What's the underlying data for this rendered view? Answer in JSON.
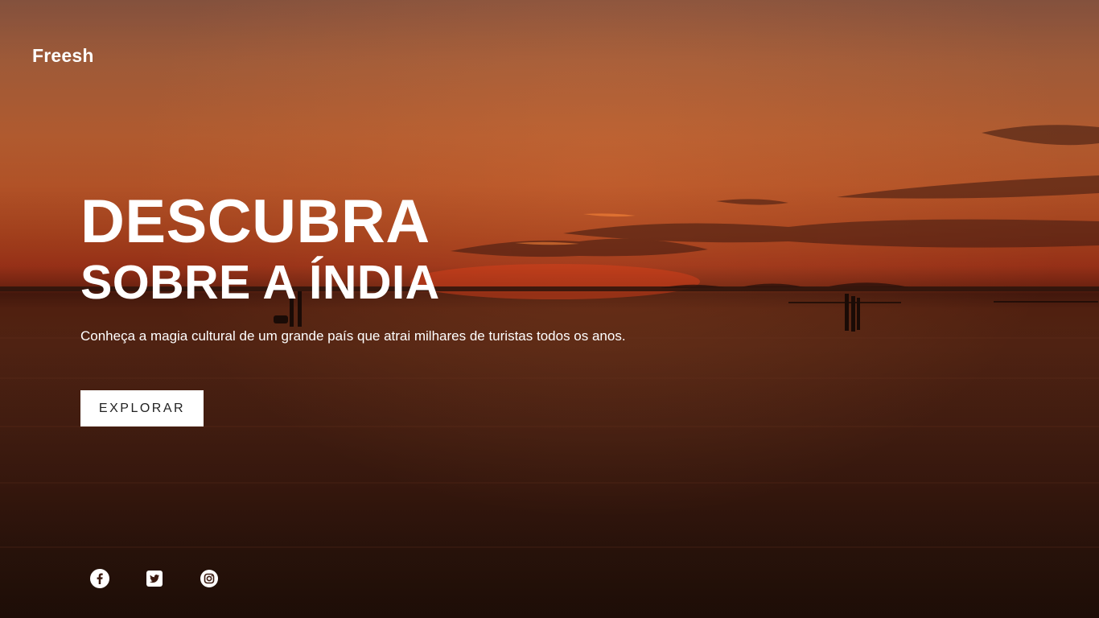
{
  "brand": {
    "name": "Freesh"
  },
  "hero": {
    "title_line1": "DESCUBRA",
    "title_line2": "SOBRE A ÍNDIA",
    "subtitle": "Conheça a magia cultural de um grande país que atrai milhares de turistas todos os anos.",
    "cta_label": "EXPLORAR"
  },
  "social": [
    {
      "icon": "facebook-icon"
    },
    {
      "icon": "twitter-icon"
    },
    {
      "icon": "instagram-icon"
    }
  ],
  "colors": {
    "text": "#ffffff",
    "button_bg": "#ffffff",
    "button_text": "#222222",
    "sky_accent": "#c25a2b"
  }
}
